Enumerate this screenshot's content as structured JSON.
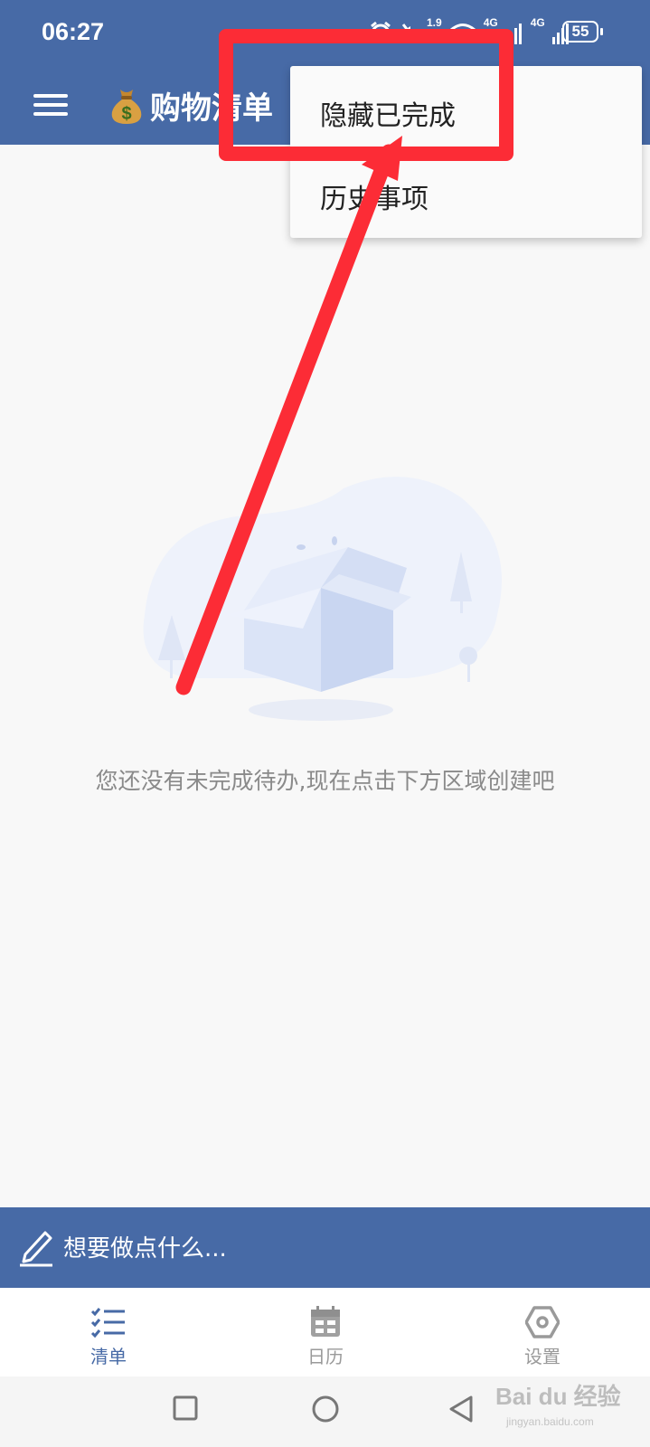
{
  "status_bar": {
    "time": "06:27",
    "signal_labels": [
      "1.9",
      "4G",
      "4G"
    ],
    "battery": "55"
  },
  "toolbar": {
    "title": "购物清单",
    "title_icon": "money-bag-icon",
    "menu_icon": "hamburger-icon"
  },
  "dropdown": {
    "items": [
      {
        "label": "隐藏已完成"
      },
      {
        "label": "历史事项"
      }
    ]
  },
  "empty_state": {
    "message": "您还没有未完成待办,现在点击下方区域创建吧",
    "illustration": "open-box-icon"
  },
  "input_bar": {
    "placeholder": "想要做点什么..."
  },
  "tabs": [
    {
      "label": "清单",
      "icon": "checklist-icon",
      "active": true
    },
    {
      "label": "日历",
      "icon": "calendar-icon",
      "active": false
    },
    {
      "label": "设置",
      "icon": "hexagon-settings-icon",
      "active": false
    }
  ],
  "watermark": {
    "text": "Bai du 经验",
    "sub": "jingyan.baidu.com"
  },
  "colors": {
    "primary": "#476aa6",
    "background": "#f8f8f8",
    "annotation": "#fc2c36"
  }
}
